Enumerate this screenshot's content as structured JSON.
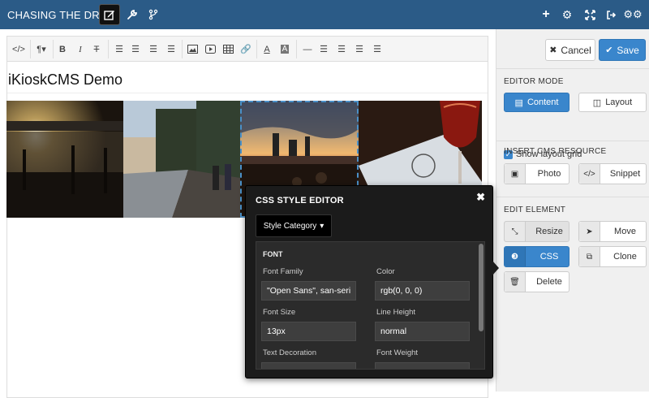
{
  "app": {
    "title": "CHASING THE DRIFT"
  },
  "topbar": {
    "left_icons": [
      "edit-icon",
      "wrench-icon",
      "branch-icon"
    ],
    "right_icons": [
      "plus-icon",
      "gear-icon",
      "expand-icon",
      "sign-out-icon",
      "cogs-icon"
    ]
  },
  "editor": {
    "toolbar_icons": [
      "code-icon",
      "paragraph-icon",
      "bold-icon",
      "italic-icon",
      "strikethrough-icon",
      "unordered-list-icon",
      "ordered-list-icon",
      "outdent-icon",
      "indent-icon",
      "image-icon",
      "video-icon",
      "table-icon",
      "link-icon",
      "text-color-icon",
      "background-color-icon",
      "horizontal-rule-icon",
      "align-left-icon",
      "align-center-icon",
      "align-right-icon",
      "justify-icon"
    ],
    "doc_title": "iKioskCMS Demo"
  },
  "sidebar": {
    "cancel_label": "Cancel",
    "save_label": "Save",
    "editor_mode_title": "EDITOR MODE",
    "content_label": "Content",
    "layout_label": "Layout",
    "show_grid_label": "Show layout grid",
    "insert_title": "INSERT CMS RESOURCE",
    "photo_label": "Photo",
    "snippet_label": "Snippet",
    "edit_title": "EDIT ELEMENT",
    "resize_label": "Resize",
    "move_label": "Move",
    "css_label": "CSS",
    "clone_label": "Clone",
    "delete_label": "Delete"
  },
  "css_editor": {
    "title": "CSS STYLE EDITOR",
    "category_label": "Style Category",
    "group": "FONT",
    "font_family_label": "Font Family",
    "font_family_value": "\"Open Sans\", san-seri",
    "color_label": "Color",
    "color_value": "rgb(0, 0, 0)",
    "font_size_label": "Font Size",
    "font_size_value": "13px",
    "line_height_label": "Line Height",
    "line_height_value": "normal",
    "text_decoration_label": "Text Decoration",
    "font_weight_label": "Font Weight"
  },
  "colors": {
    "topbar": "#2b5b87",
    "primary": "#3a86cc",
    "popover": "#1b1b1b"
  }
}
